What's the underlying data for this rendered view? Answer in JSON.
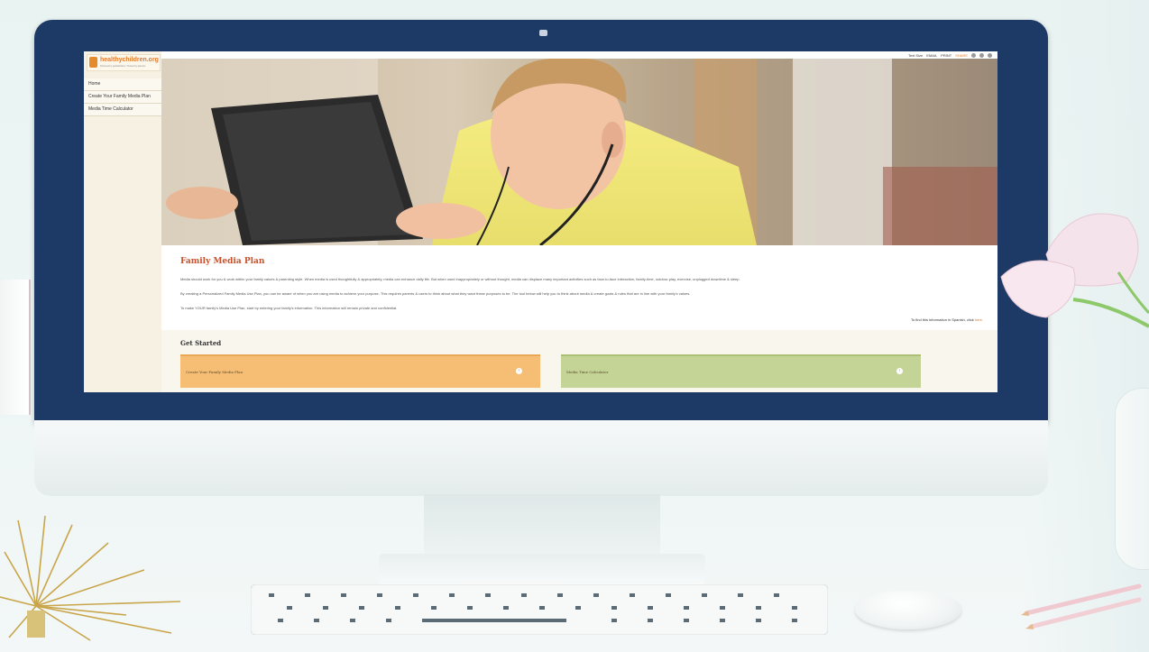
{
  "site": {
    "logo_text": "healthychildren.org",
    "logo_sub": "Powered by pediatricians. Trusted by parents."
  },
  "nav": {
    "items": [
      "Home",
      "Create Your Family Media Plan",
      "Media Time Calculator"
    ]
  },
  "topbar": {
    "text_size": "Text Size",
    "email": "EMAIL",
    "print": "PRINT",
    "share": "SHARE"
  },
  "content": {
    "title": "Family Media Plan",
    "paragraphs": [
      "Media should work for you & work within your family values & parenting style. When media is used thoughtfully & appropriately, media can enhance daily life. But when used inappropriately or without thought, media can displace many important activities such as face-to-face interaction, family-time, outdoor-play, exercise, unplugged downtime & sleep.",
      "By creating a Personalized Family Media Use Plan, you can be aware of when you are using media to achieve your purpose. This requires parents & users to think about what they want these purposes to be. The tool below will help you to think about media & create goals & rules that are in line with your family's values.",
      "To make YOUR family's Media Use Plan, start by entering your family's information. This information will remain private and confidential."
    ],
    "spanish_prefix": "To find this information in Spanish, click",
    "spanish_link": "here."
  },
  "get_started": {
    "title": "Get Started",
    "cards": [
      {
        "label": "Create Your Family Media Plan"
      },
      {
        "label": "Media Time Calculator"
      }
    ]
  },
  "icons": {
    "card_arrow": "chevron-right-icon",
    "camera": "camera-icon"
  },
  "colors": {
    "bezel": "#1d3a66",
    "title": "#c8502a",
    "orange_card": "#f6be75",
    "green_card": "#c4d497",
    "sidebar": "#f7f1e3"
  }
}
